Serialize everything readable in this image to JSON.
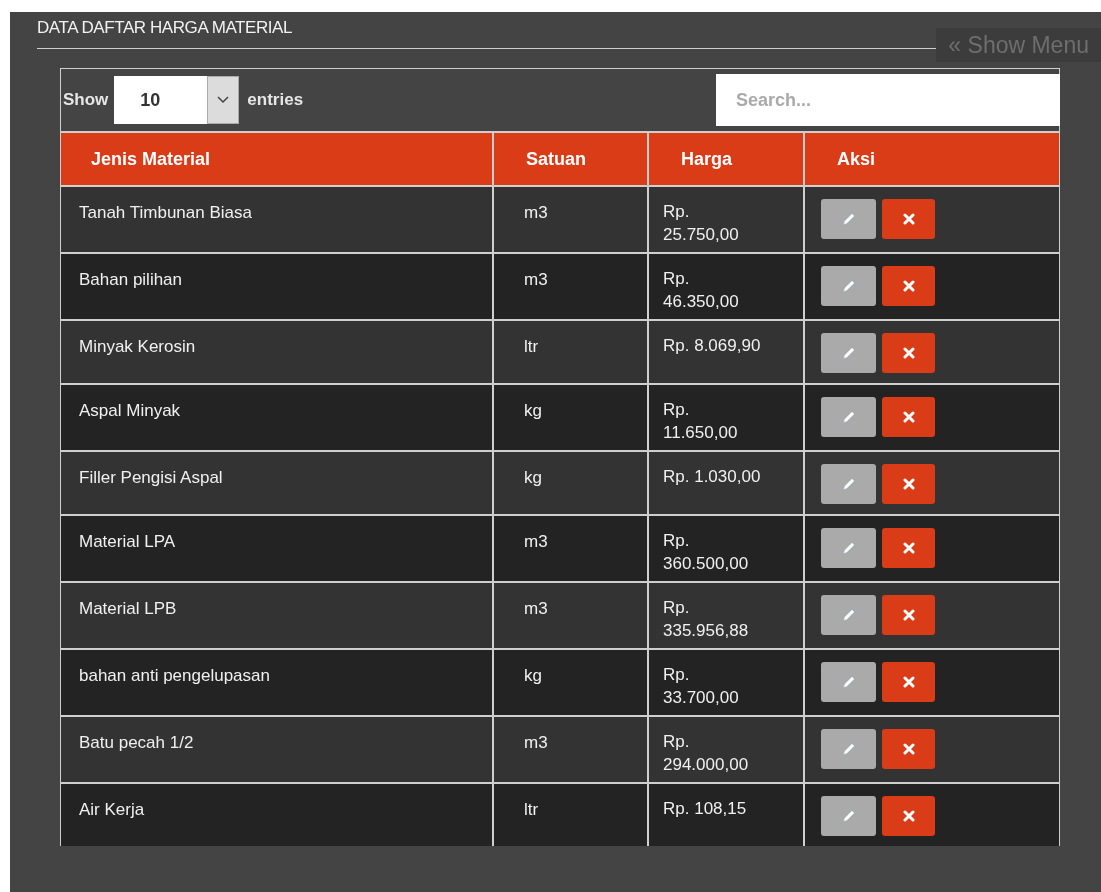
{
  "panel": {
    "title": "DATA DAFTAR HARGA MATERIAL",
    "show_menu": "« Show Menu"
  },
  "length_control": {
    "label_before": "Show",
    "value": "10",
    "label_after": "entries"
  },
  "search": {
    "placeholder": "Search..."
  },
  "table": {
    "columns": [
      "Jenis Material",
      "Satuan",
      "Harga",
      "Aksi"
    ],
    "rows": [
      {
        "material": "Tanah Timbunan Biasa",
        "unit": "m3",
        "price": "Rp. 25.750,00"
      },
      {
        "material": "Bahan pilihan",
        "unit": "m3",
        "price": "Rp. 46.350,00"
      },
      {
        "material": "Minyak Kerosin",
        "unit": "ltr",
        "price": "Rp. 8.069,90"
      },
      {
        "material": "Aspal Minyak",
        "unit": "kg",
        "price": "Rp. 11.650,00"
      },
      {
        "material": "Filler Pengisi Aspal",
        "unit": "kg",
        "price": "Rp. 1.030,00"
      },
      {
        "material": "Material LPA",
        "unit": "m3",
        "price": "Rp. 360.500,00"
      },
      {
        "material": "Material LPB",
        "unit": "m3",
        "price": "Rp. 335.956,88"
      },
      {
        "material": "bahan anti pengelupasan",
        "unit": "kg",
        "price": "Rp. 33.700,00"
      },
      {
        "material": "Batu pecah 1/2",
        "unit": "m3",
        "price": "Rp. 294.000,00"
      },
      {
        "material": "Air Kerja",
        "unit": "ltr",
        "price": "Rp. 108,15"
      }
    ]
  }
}
